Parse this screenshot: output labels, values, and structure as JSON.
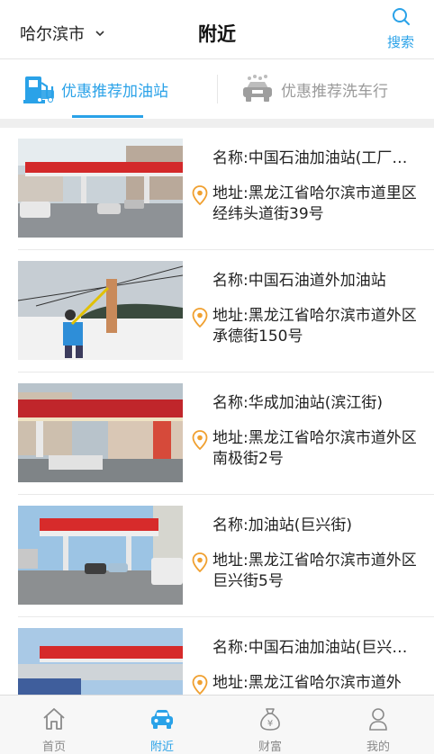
{
  "header": {
    "city": "哈尔滨市",
    "title": "附近",
    "search_label": "搜索"
  },
  "tabs": [
    {
      "label": "优惠推荐加油站",
      "active": true
    },
    {
      "label": "优惠推荐洗车行",
      "active": false
    }
  ],
  "stations": [
    {
      "name": "名称:中国石油加油站(工厂…",
      "address": "地址:黑龙江省哈尔滨市道里区经纬头道街39号"
    },
    {
      "name": "名称:中国石油道外加油站",
      "address": "地址:黑龙江省哈尔滨市道外区承德街150号"
    },
    {
      "name": "名称:华成加油站(滨江街)",
      "address": "地址:黑龙江省哈尔滨市道外区南极街2号"
    },
    {
      "name": "名称:加油站(巨兴街)",
      "address": "地址:黑龙江省哈尔滨市道外区巨兴街5号"
    },
    {
      "name": "名称:中国石油加油站(巨兴…",
      "address": "地址:黑龙江省哈尔滨市道外"
    }
  ],
  "bottom_nav": [
    {
      "label": "首页",
      "icon": "home-icon",
      "active": false
    },
    {
      "label": "附近",
      "icon": "car-icon",
      "active": true
    },
    {
      "label": "财富",
      "icon": "money-bag-icon",
      "active": false
    },
    {
      "label": "我的",
      "icon": "user-icon",
      "active": false
    }
  ],
  "colors": {
    "accent": "#2aa2e8",
    "pin": "#f0a030",
    "inactive": "#8a8a8a"
  }
}
